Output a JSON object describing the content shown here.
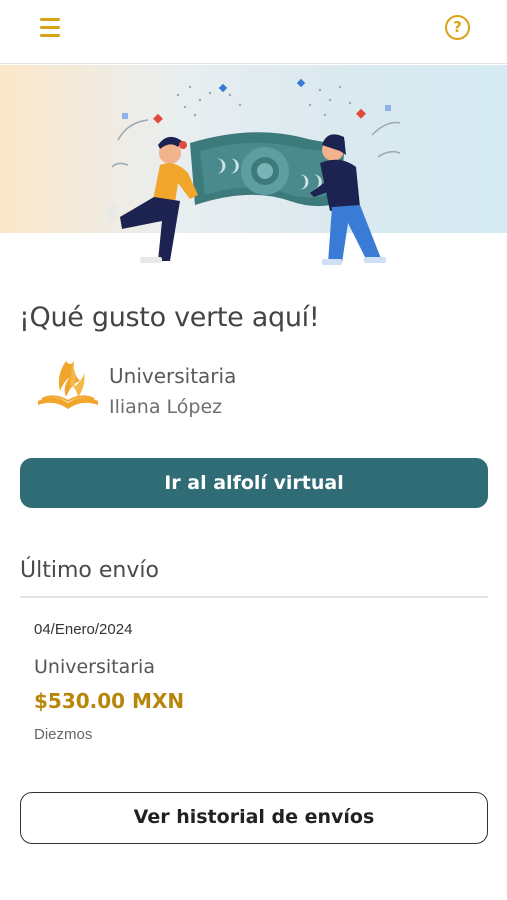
{
  "header": {
    "menu_icon": "hamburger-menu-icon",
    "help_icon": "question-circle-icon",
    "help_glyph": "?"
  },
  "hero": {
    "illustration": "two-people-holding-banknote-illustration"
  },
  "greeting": "¡Qué gusto verte aquí!",
  "church": {
    "logo_icon": "church-flame-bible-logo",
    "name": "Universitaria",
    "member": "Iliana López"
  },
  "primary_button": "Ir al alfolí virtual",
  "last_shipment": {
    "title": "Último envío",
    "date": "04/Enero/2024",
    "church": "Universitaria",
    "amount": "$530.00 MXN",
    "concept": "Diezmos"
  },
  "secondary_button": "Ver historial de envíos",
  "colors": {
    "accent": "#d9a21b",
    "primary_button_bg": "#2f6c76",
    "amount": "#b8860b"
  }
}
